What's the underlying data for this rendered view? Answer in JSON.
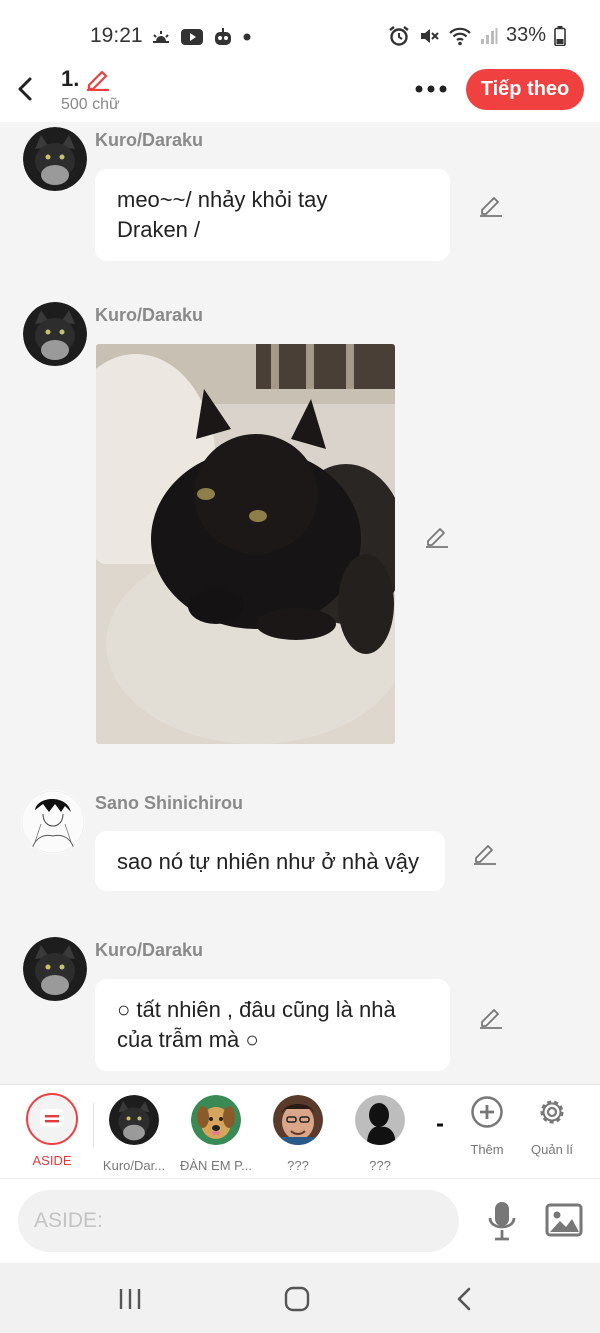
{
  "status_bar": {
    "time": "19:21",
    "battery": "33%"
  },
  "header": {
    "chapter": "1.",
    "word_count": "500 chữ",
    "next_label": "Tiếp theo"
  },
  "messages": [
    {
      "sender": "Kuro/Daraku",
      "type": "text",
      "text_lines": [
        "meo~~/ nhảy khỏi tay",
        "Draken /"
      ]
    },
    {
      "sender": "Kuro/Daraku",
      "type": "image"
    },
    {
      "sender": "Sano Shinichirou",
      "type": "text",
      "text_lines": [
        "sao nó tự nhiên như ở nhà vậy"
      ]
    },
    {
      "sender": "Kuro/Daraku",
      "type": "text",
      "text_lines": [
        "○ tất nhiên , đâu cũng là nhà",
        "của trẫm mà ○"
      ]
    }
  ],
  "characters": {
    "aside_label": "ASIDE",
    "items": [
      {
        "name": "Kuro/Dar..."
      },
      {
        "name": "ĐÀN EM P..."
      },
      {
        "name": "???"
      },
      {
        "name": "???"
      }
    ],
    "add_label": "Thêm",
    "manage_label": "Quản lí"
  },
  "input": {
    "placeholder": "ASIDE:"
  },
  "colors": {
    "accent": "#f04040",
    "background": "#f4f4f4",
    "bubble": "#ffffff"
  },
  "icons": [
    "back-arrow-icon",
    "pencil-icon",
    "more-icon",
    "microphone-icon",
    "image-icon",
    "plus-circle-icon",
    "gear-icon"
  ]
}
